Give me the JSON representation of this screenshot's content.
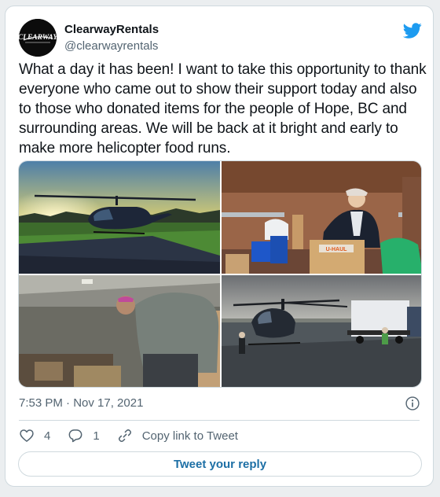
{
  "tweet": {
    "author": {
      "display_name": "ClearwayRentals",
      "handle": "@clearwayrentals",
      "avatar_logo_text": "CLEARWAY"
    },
    "text": "What a day it has been! I want to take this opportunity to thank everyone who came out to show their support today and also to those who donated items for the people of Hope, BC and surrounding areas. We will be back at it bright and early to make more helicopter food runs.",
    "timestamp": "7:53 PM · Nov 17, 2021",
    "media": {
      "count": 4,
      "box_label": "U-HAUL"
    },
    "actions": {
      "like_count": "4",
      "reply_count": "1",
      "copy_link_label": "Copy link to Tweet"
    },
    "reply_button_label": "Tweet your reply"
  },
  "colors": {
    "twitter_blue": "#1d9bf0",
    "muted_text": "#536471",
    "border": "#cfd9de",
    "reply_link": "#1d6fa5"
  },
  "icons": [
    "twitter-bird-icon",
    "info-icon",
    "heart-icon",
    "reply-bubble-icon",
    "link-icon"
  ]
}
